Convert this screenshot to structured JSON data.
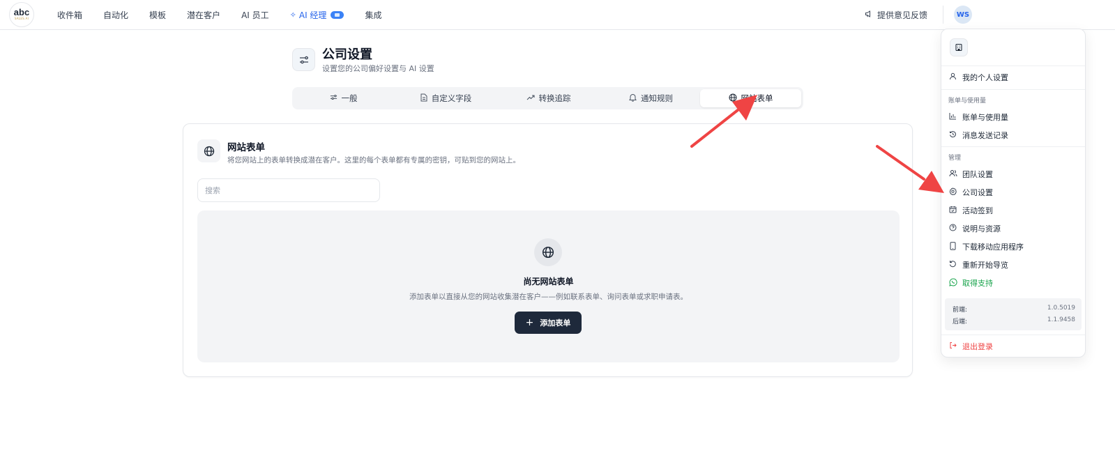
{
  "logo": {
    "main": "abc",
    "sub": "SALES.AI"
  },
  "nav": {
    "items": [
      "收件箱",
      "自动化",
      "模板",
      "潜在客户",
      "AI 员工"
    ],
    "ai_manager": "AI 经理",
    "integrations": "集成"
  },
  "topbar": {
    "feedback": "提供意见反馈",
    "avatar_initials": "WS"
  },
  "page": {
    "title": "公司设置",
    "subtitle": "设置您的公司偏好设置与 AI 设置"
  },
  "tabs": [
    {
      "label": "一般",
      "icon": "sliders-icon"
    },
    {
      "label": "自定义字段",
      "icon": "file-text-icon"
    },
    {
      "label": "转换追踪",
      "icon": "trending-up-icon"
    },
    {
      "label": "通知规则",
      "icon": "bell-icon"
    },
    {
      "label": "网站表单",
      "icon": "globe-icon",
      "active": true
    }
  ],
  "card": {
    "title": "网站表单",
    "description": "将您网站上的表单转换成潜在客户。这里的每个表单都有专属的密钥，可贴到您的网站上。",
    "search_placeholder": "搜索",
    "empty_title": "尚无网站表单",
    "empty_description": "添加表单以直接从您的网站收集潜在客户——例如联系表单、询问表单或求职申请表。",
    "add_button": "添加表单"
  },
  "dropdown": {
    "personal_settings": "我的个人设置",
    "billing_section": "账单与使用量",
    "billing": "账单与使用量",
    "message_log": "消息发送记录",
    "manage_section": "管理",
    "team_settings": "团队设置",
    "company_settings": "公司设置",
    "activity_checkin": "活动签到",
    "help_resources": "说明与资源",
    "download_app": "下载移动应用程序",
    "restart_tour": "重新开始导览",
    "get_support": "取得支持",
    "frontend_label": "前端:",
    "frontend_version": "1.0.5019",
    "backend_label": "后端:",
    "backend_version": "1.1.9458",
    "logout": "退出登录"
  },
  "colors": {
    "accent": "#2563eb",
    "annotation_arrow": "#ef4444",
    "button_dark": "#1e293b",
    "support_green": "#16a34a"
  }
}
